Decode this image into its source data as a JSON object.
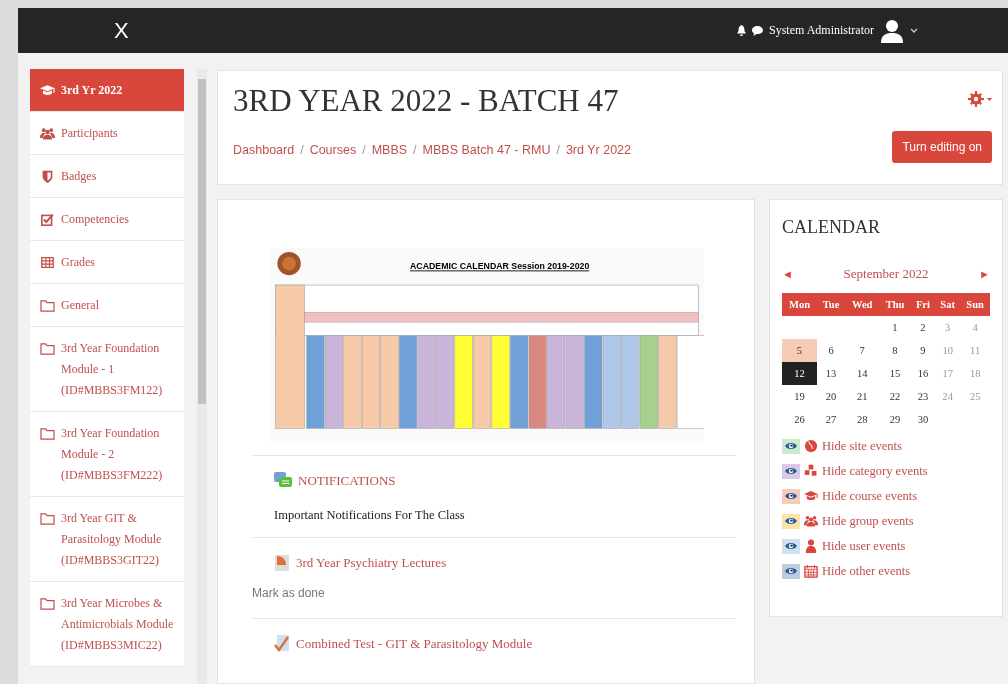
{
  "topbar": {
    "close_label": "X",
    "user_name": "System Administrator"
  },
  "sidebar": {
    "items": [
      {
        "label": "3rd Yr 2022",
        "kind": "course",
        "selected": true
      },
      {
        "label": "Participants",
        "kind": "users",
        "selected": false
      },
      {
        "label": "Badges",
        "kind": "shield",
        "selected": false
      },
      {
        "label": "Competencies",
        "kind": "check",
        "selected": false
      },
      {
        "label": "Grades",
        "kind": "table",
        "selected": false
      },
      {
        "label": "General",
        "kind": "folder",
        "selected": false
      },
      {
        "label": "3rd Year Foundation Module - 1 (ID#MBBS3FM122)",
        "kind": "folder",
        "selected": false
      },
      {
        "label": "3rd Year Foundation Module - 2 (ID#MBBS3FM222)",
        "kind": "folder",
        "selected": false
      },
      {
        "label": "3rd Year GIT & Parasitology Module (ID#MBBS3GIT22)",
        "kind": "folder",
        "selected": false
      },
      {
        "label": "3rd Year Microbes & Antimicrobials Module (ID#MBBS3MIC22)",
        "kind": "folder",
        "selected": false
      }
    ]
  },
  "header": {
    "title": "3RD YEAR 2022 - BATCH 47",
    "breadcrumbs": [
      {
        "label": "Dashboard"
      },
      {
        "separator": "/",
        "label": "Courses"
      },
      {
        "separator": "/",
        "label": "MBBS"
      },
      {
        "separator": "/",
        "label": "MBBS Batch 47 - RMU"
      },
      {
        "separator": "/",
        "label": "3rd Yr 2022"
      }
    ],
    "edit_button": "Turn editing on"
  },
  "content": {
    "banner_title": "ACADEMIC CALENDAR Session 2019-2020",
    "activities": [
      {
        "kind": "forum",
        "title": "NOTIFICATIONS",
        "description": "Important Notifications For The Class"
      },
      {
        "kind": "file",
        "title": "3rd Year Psychiatry Lectures",
        "action": "Mark as done"
      },
      {
        "kind": "quiz",
        "title": "Combined Test - GIT & Parasitology Module"
      }
    ]
  },
  "calendar": {
    "title": "CALENDAR",
    "month": "September 2022",
    "prev": "◄",
    "next": "►",
    "weekdays": [
      "Mon",
      "Tue",
      "Wed",
      "Thu",
      "Fri",
      "Sat",
      "Sun"
    ],
    "weeks": [
      {
        "days": [
          {
            "day": "1",
            "event": false,
            "today": false
          },
          {
            "day": "2",
            "event": false,
            "today": false
          },
          {
            "day": "3",
            "event": false,
            "today": false
          },
          {
            "day": "4",
            "event": false,
            "today": false
          }
        ]
      },
      {
        "days": [
          {
            "day": "5",
            "event": true,
            "today": false
          },
          {
            "day": "6",
            "event": false,
            "today": false
          },
          {
            "day": "7",
            "event": false,
            "today": false
          },
          {
            "day": "8",
            "event": false,
            "today": false
          },
          {
            "day": "9",
            "event": false,
            "today": false
          },
          {
            "day": "10",
            "event": false,
            "today": false
          },
          {
            "day": "11",
            "event": false,
            "today": false
          }
        ]
      },
      {
        "days": [
          {
            "day": "12",
            "event": false,
            "today": true
          },
          {
            "day": "13",
            "event": false,
            "today": false
          },
          {
            "day": "14",
            "event": false,
            "today": false
          },
          {
            "day": "15",
            "event": false,
            "today": false
          },
          {
            "day": "16",
            "event": false,
            "today": false
          },
          {
            "day": "17",
            "event": false,
            "today": false
          },
          {
            "day": "18",
            "event": false,
            "today": false
          }
        ]
      },
      {
        "days": [
          {
            "day": "19",
            "event": false,
            "today": false
          },
          {
            "day": "20",
            "event": false,
            "today": false
          },
          {
            "day": "21",
            "event": false,
            "today": false
          },
          {
            "day": "22",
            "event": false,
            "today": false
          },
          {
            "day": "23",
            "event": false,
            "today": false
          },
          {
            "day": "24",
            "event": false,
            "today": false
          },
          {
            "day": "25",
            "event": false,
            "today": false
          }
        ]
      },
      {
        "days": [
          {
            "day": "26",
            "event": false,
            "today": false
          },
          {
            "day": "27",
            "event": false,
            "today": false
          },
          {
            "day": "28",
            "event": false,
            "today": false
          },
          {
            "day": "29",
            "event": false,
            "today": false
          },
          {
            "day": "30",
            "event": false,
            "today": false
          }
        ]
      }
    ],
    "filters": [
      {
        "label": "Hide site events",
        "kind": "globe",
        "color": "#c9ecc9"
      },
      {
        "label": "Hide category events",
        "kind": "cubes",
        "color": "#d9c8e6"
      },
      {
        "label": "Hide course events",
        "kind": "course",
        "color": "#f7cdb8"
      },
      {
        "label": "Hide group events",
        "kind": "users",
        "color": "#fbe3a6"
      },
      {
        "label": "Hide user events",
        "kind": "user",
        "color": "#cfe0ee"
      },
      {
        "label": "Hide other events",
        "kind": "calendar",
        "color": "#bcccdc"
      }
    ]
  }
}
